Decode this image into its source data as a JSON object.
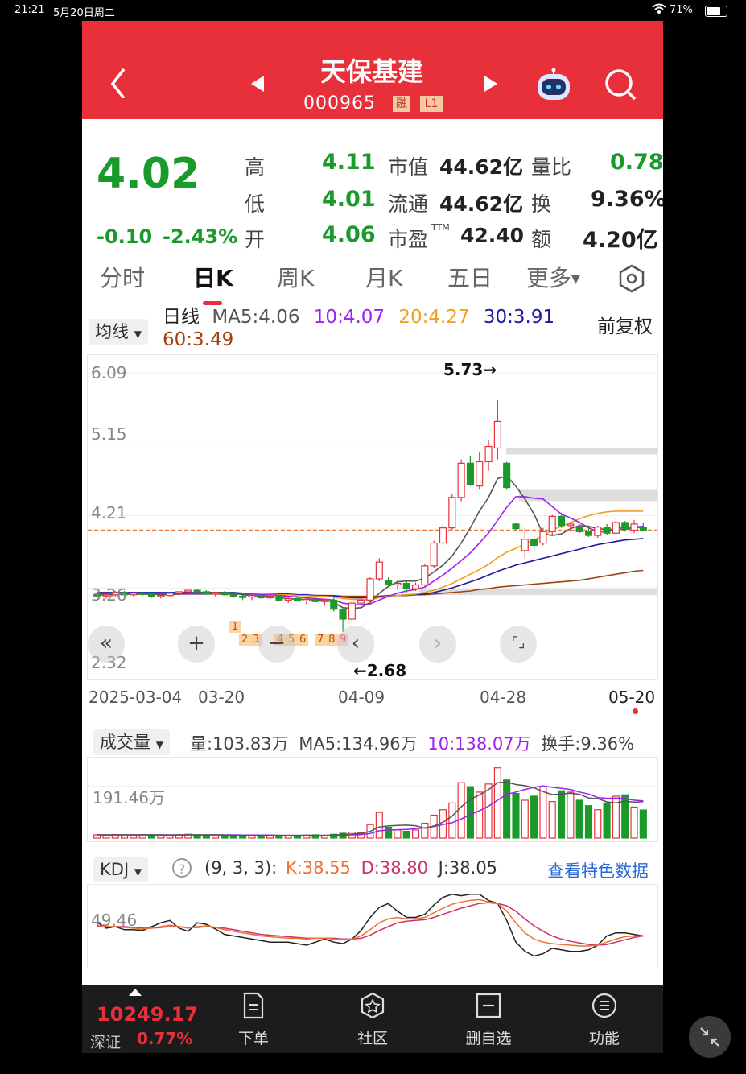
{
  "status": {
    "time": "21:21",
    "date": "5月20日周二",
    "battery": "71%"
  },
  "header": {
    "title": "天保基建",
    "code": "000965",
    "badge_rong": "融",
    "badge_level": "L1"
  },
  "quote": {
    "price": "4.02",
    "change": "-0.10",
    "change_pct": "-2.43%",
    "high_label": "高",
    "high": "4.11",
    "low_label": "低",
    "low": "4.01",
    "open_label": "开",
    "open": "4.06",
    "mktcap_label": "市值",
    "mktcap": "44.62亿",
    "float_label": "流通",
    "float": "44.62亿",
    "pe_label": "市盈",
    "pe_sup": "TTM",
    "pe": "42.40",
    "volratio_label": "量比",
    "volratio": "0.78",
    "turnover_label": "换",
    "turnover": "9.36%",
    "amount_label": "额",
    "amount": "4.20亿"
  },
  "tabs": [
    "分时",
    "日K",
    "周K",
    "月K",
    "五日",
    "更多"
  ],
  "kline": {
    "indicator": "均线",
    "period": "日线",
    "ma5": "MA5:4.06",
    "ma10": "10:4.07",
    "ma20": "20:4.27",
    "ma30": "30:3.91",
    "ma60": "60:3.49",
    "adjust": "前复权",
    "y_labels": [
      "6.09",
      "5.15",
      "4.21",
      "3.26",
      "2.32"
    ],
    "high_mark": "5.73→",
    "low_mark": "←2.68",
    "x_labels": [
      "2025-03-04",
      "03-20",
      "04-09",
      "04-28",
      "05-20"
    ],
    "digits": [
      "1",
      "2",
      "3",
      "4",
      "5",
      "6",
      "7",
      "8",
      "9"
    ],
    "controls": [
      "«",
      "+",
      "−",
      "‹",
      "›",
      "⌜⌟"
    ]
  },
  "volume": {
    "indicator": "成交量",
    "vol": "量:103.83万",
    "ma5": "MA5:134.96万",
    "ma10": "10:138.07万",
    "turnover": "换手:9.36%",
    "y_label": "191.46万"
  },
  "kdj": {
    "indicator": "KDJ",
    "params": "(9, 3, 3):",
    "k": "K:38.55",
    "d": "D:38.80",
    "j": "J:38.05",
    "link": "查看特色数据",
    "y_label": "49.46"
  },
  "bottom": {
    "index_value": "10249.17",
    "index_name": "深证",
    "index_pct": "0.77%",
    "nav": [
      "下单",
      "社区",
      "删自选",
      "功能"
    ]
  },
  "colors": {
    "up": "#e8303a",
    "down": "#1a9a2a",
    "header": "#e8303a",
    "ma10": "#a020f0",
    "ma20": "#f0a020",
    "ma30": "#1a1aa0",
    "ma60": "#a04010"
  },
  "chart_data": [
    {
      "type": "candlestick",
      "title": "",
      "ylim": [
        2.32,
        6.09
      ],
      "x_ticks": [
        "2025-03-04",
        "03-20",
        "04-09",
        "04-28",
        "05-20"
      ],
      "candles": [
        [
          3.17,
          3.2,
          3.12,
          3.16
        ],
        [
          3.16,
          3.18,
          3.12,
          3.17
        ],
        [
          3.17,
          3.22,
          3.14,
          3.2
        ],
        [
          3.2,
          3.22,
          3.15,
          3.17
        ],
        [
          3.17,
          3.21,
          3.14,
          3.19
        ],
        [
          3.19,
          3.21,
          3.16,
          3.18
        ],
        [
          3.18,
          3.19,
          3.13,
          3.15
        ],
        [
          3.15,
          3.18,
          3.12,
          3.16
        ],
        [
          3.16,
          3.2,
          3.14,
          3.19
        ],
        [
          3.19,
          3.22,
          3.16,
          3.21
        ],
        [
          3.21,
          3.24,
          3.18,
          3.23
        ],
        [
          3.23,
          3.25,
          3.19,
          3.21
        ],
        [
          3.21,
          3.23,
          3.17,
          3.18
        ],
        [
          3.18,
          3.21,
          3.15,
          3.2
        ],
        [
          3.2,
          3.22,
          3.16,
          3.17
        ],
        [
          3.17,
          3.19,
          3.13,
          3.15
        ],
        [
          3.15,
          3.18,
          3.1,
          3.14
        ],
        [
          3.14,
          3.17,
          3.1,
          3.16
        ],
        [
          3.16,
          3.18,
          3.12,
          3.13
        ],
        [
          3.13,
          3.16,
          3.1,
          3.15
        ],
        [
          3.15,
          3.17,
          3.08,
          3.1
        ],
        [
          3.1,
          3.14,
          3.06,
          3.12
        ],
        [
          3.12,
          3.15,
          3.08,
          3.09
        ],
        [
          3.09,
          3.13,
          3.05,
          3.11
        ],
        [
          3.11,
          3.14,
          3.07,
          3.08
        ],
        [
          3.08,
          3.12,
          3.04,
          3.1
        ],
        [
          3.1,
          3.13,
          2.95,
          2.98
        ],
        [
          2.98,
          3.0,
          2.68,
          2.85
        ],
        [
          2.85,
          3.08,
          2.82,
          3.06
        ],
        [
          3.06,
          3.12,
          3.02,
          3.1
        ],
        [
          3.1,
          3.4,
          3.08,
          3.38
        ],
        [
          3.38,
          3.65,
          3.35,
          3.6
        ],
        [
          3.36,
          3.4,
          3.28,
          3.3
        ],
        [
          3.3,
          3.36,
          3.24,
          3.32
        ],
        [
          3.32,
          3.36,
          3.2,
          3.25
        ],
        [
          3.25,
          3.33,
          3.22,
          3.3
        ],
        [
          3.3,
          3.58,
          3.28,
          3.55
        ],
        [
          3.55,
          3.88,
          3.52,
          3.85
        ],
        [
          3.85,
          4.1,
          3.82,
          4.05
        ],
        [
          4.05,
          4.5,
          4.02,
          4.45
        ],
        [
          4.45,
          4.95,
          4.4,
          4.9
        ],
        [
          4.9,
          5.0,
          4.6,
          4.62
        ],
        [
          4.6,
          5.05,
          4.55,
          4.92
        ],
        [
          4.92,
          5.2,
          4.8,
          5.12
        ],
        [
          5.1,
          5.73,
          4.95,
          5.45
        ],
        [
          4.9,
          4.92,
          4.55,
          4.58
        ],
        [
          4.1,
          4.12,
          4.02,
          4.04
        ],
        [
          3.75,
          4.05,
          3.65,
          3.9
        ],
        [
          3.9,
          3.96,
          3.75,
          3.82
        ],
        [
          3.85,
          4.05,
          3.82,
          4.0
        ],
        [
          4.0,
          4.22,
          3.95,
          4.2
        ],
        [
          4.2,
          4.25,
          4.05,
          4.08
        ],
        [
          4.08,
          4.12,
          4.0,
          4.1
        ],
        [
          4.05,
          4.1,
          3.98,
          4.0
        ],
        [
          4.0,
          4.06,
          3.93,
          3.95
        ],
        [
          3.95,
          4.08,
          3.92,
          4.06
        ],
        [
          4.06,
          4.1,
          3.96,
          3.98
        ],
        [
          3.98,
          4.18,
          3.95,
          4.12
        ],
        [
          4.12,
          4.14,
          4.0,
          4.03
        ],
        [
          4.02,
          4.15,
          3.98,
          4.1
        ],
        [
          4.06,
          4.11,
          4.01,
          4.02
        ]
      ],
      "ma5": [
        3.17,
        3.17,
        3.17,
        3.18,
        3.18,
        3.18,
        3.18,
        3.17,
        3.17,
        3.18,
        3.19,
        3.2,
        3.2,
        3.2,
        3.2,
        3.19,
        3.17,
        3.16,
        3.15,
        3.15,
        3.13,
        3.12,
        3.11,
        3.11,
        3.1,
        3.1,
        3.07,
        3.0,
        2.99,
        3.0,
        3.07,
        3.19,
        3.28,
        3.34,
        3.35,
        3.35,
        3.39,
        3.47,
        3.56,
        3.68,
        3.85,
        4.05,
        4.27,
        4.45,
        4.7,
        4.73,
        4.6,
        4.43,
        4.23,
        3.97,
        3.95,
        3.97,
        4.04,
        4.08,
        4.07,
        4.04,
        4.03,
        4.03,
        4.03,
        4.05,
        4.06
      ],
      "ma10": [
        3.18,
        3.18,
        3.18,
        3.18,
        3.18,
        3.18,
        3.18,
        3.18,
        3.18,
        3.18,
        3.18,
        3.18,
        3.18,
        3.19,
        3.19,
        3.19,
        3.18,
        3.18,
        3.17,
        3.17,
        3.16,
        3.15,
        3.14,
        3.13,
        3.12,
        3.11,
        3.1,
        3.06,
        3.04,
        3.04,
        3.05,
        3.1,
        3.15,
        3.19,
        3.22,
        3.24,
        3.27,
        3.35,
        3.43,
        3.52,
        3.62,
        3.72,
        3.85,
        3.98,
        4.15,
        4.32,
        4.46,
        4.46,
        4.44,
        4.43,
        4.33,
        4.23,
        4.18,
        4.12,
        4.05,
        4.0,
        4.0,
        4.04,
        4.06,
        4.06,
        4.07
      ],
      "ma20": [
        3.19,
        3.19,
        3.19,
        3.19,
        3.19,
        3.19,
        3.19,
        3.19,
        3.19,
        3.19,
        3.19,
        3.19,
        3.19,
        3.19,
        3.19,
        3.19,
        3.19,
        3.19,
        3.18,
        3.18,
        3.17,
        3.17,
        3.16,
        3.16,
        3.15,
        3.15,
        3.14,
        3.12,
        3.11,
        3.11,
        3.1,
        3.13,
        3.15,
        3.16,
        3.17,
        3.18,
        3.2,
        3.23,
        3.27,
        3.32,
        3.38,
        3.44,
        3.5,
        3.57,
        3.66,
        3.73,
        3.78,
        3.84,
        3.89,
        3.95,
        4.02,
        4.07,
        4.12,
        4.17,
        4.21,
        4.24,
        4.26,
        4.27,
        4.27,
        4.27,
        4.27
      ],
      "ma30": [
        3.2,
        3.2,
        3.2,
        3.2,
        3.2,
        3.2,
        3.2,
        3.2,
        3.2,
        3.2,
        3.2,
        3.2,
        3.2,
        3.2,
        3.2,
        3.2,
        3.19,
        3.19,
        3.19,
        3.19,
        3.18,
        3.18,
        3.17,
        3.17,
        3.16,
        3.16,
        3.15,
        3.14,
        3.13,
        3.13,
        3.13,
        3.14,
        3.15,
        3.16,
        3.17,
        3.17,
        3.18,
        3.2,
        3.23,
        3.26,
        3.3,
        3.34,
        3.38,
        3.43,
        3.48,
        3.52,
        3.56,
        3.59,
        3.62,
        3.65,
        3.68,
        3.71,
        3.74,
        3.77,
        3.8,
        3.83,
        3.85,
        3.87,
        3.89,
        3.9,
        3.91
      ],
      "ma60": [
        3.18,
        3.18,
        3.18,
        3.18,
        3.18,
        3.18,
        3.18,
        3.18,
        3.18,
        3.18,
        3.18,
        3.18,
        3.18,
        3.18,
        3.18,
        3.18,
        3.18,
        3.18,
        3.18,
        3.17,
        3.17,
        3.17,
        3.17,
        3.16,
        3.16,
        3.16,
        3.16,
        3.15,
        3.15,
        3.15,
        3.15,
        3.15,
        3.16,
        3.16,
        3.16,
        3.17,
        3.17,
        3.18,
        3.19,
        3.2,
        3.21,
        3.22,
        3.24,
        3.25,
        3.27,
        3.28,
        3.29,
        3.3,
        3.31,
        3.32,
        3.33,
        3.34,
        3.35,
        3.36,
        3.38,
        3.4,
        3.42,
        3.44,
        3.46,
        3.48,
        3.49
      ]
    },
    {
      "type": "bar",
      "title": "",
      "y_label_value": "191.46万",
      "ylim": [
        0,
        280
      ],
      "volumes": [
        12,
        11,
        13,
        12,
        11,
        13,
        12,
        11,
        10,
        12,
        14,
        12,
        10,
        11,
        10,
        9,
        10,
        9,
        9,
        10,
        10,
        9,
        10,
        11,
        12,
        10,
        14,
        18,
        22,
        20,
        50,
        95,
        40,
        30,
        25,
        30,
        55,
        85,
        105,
        130,
        205,
        190,
        170,
        200,
        260,
        215,
        165,
        140,
        155,
        190,
        135,
        175,
        170,
        140,
        120,
        105,
        130,
        155,
        160,
        115,
        104
      ],
      "vol_ma5": [
        12,
        12,
        12,
        12,
        12,
        12,
        12,
        12,
        11,
        12,
        12,
        12,
        12,
        12,
        11,
        10,
        10,
        10,
        10,
        10,
        10,
        10,
        10,
        10,
        10,
        10,
        11,
        13,
        15,
        17,
        25,
        41,
        45,
        47,
        48,
        46,
        36,
        45,
        59,
        81,
        116,
        143,
        160,
        179,
        205,
        207,
        198,
        194,
        186,
        172,
        161,
        163,
        166,
        162,
        148,
        146,
        134,
        130,
        136,
        133,
        135
      ],
      "vol_ma10": [
        12,
        12,
        12,
        12,
        12,
        12,
        12,
        12,
        12,
        12,
        12,
        12,
        12,
        12,
        12,
        12,
        11,
        11,
        11,
        11,
        10,
        10,
        10,
        10,
        10,
        10,
        10,
        11,
        12,
        13,
        17,
        27,
        30,
        31,
        32,
        35,
        38,
        43,
        50,
        57,
        71,
        87,
        101,
        118,
        140,
        162,
        170,
        180,
        188,
        193,
        188,
        184,
        180,
        170,
        163,
        150,
        147,
        148,
        146,
        140,
        138
      ],
      "up_flags": [
        1,
        1,
        1,
        1,
        1,
        1,
        0,
        1,
        1,
        1,
        1,
        0,
        0,
        1,
        0,
        0,
        0,
        1,
        0,
        1,
        0,
        1,
        0,
        1,
        0,
        1,
        0,
        0,
        1,
        1,
        1,
        1,
        0,
        1,
        0,
        1,
        1,
        1,
        1,
        1,
        1,
        0,
        1,
        1,
        1,
        0,
        0,
        1,
        0,
        1,
        1,
        0,
        1,
        0,
        0,
        1,
        0,
        1,
        0,
        1,
        0
      ]
    },
    {
      "type": "line",
      "title": "",
      "y_label_value": "49.46",
      "ylim": [
        0,
        100
      ],
      "K": [
        52,
        50,
        50,
        49,
        48,
        47,
        48,
        50,
        52,
        50,
        48,
        50,
        51,
        49,
        46,
        44,
        42,
        40,
        38,
        37,
        36,
        35,
        35,
        34,
        35,
        35,
        34,
        33,
        34,
        38,
        46,
        55,
        60,
        62,
        60,
        60,
        62,
        68,
        74,
        79,
        82,
        84,
        85,
        82,
        80,
        70,
        55,
        42,
        34,
        30,
        28,
        27,
        26,
        25,
        25,
        26,
        30,
        34,
        37,
        38,
        38
      ],
      "D": [
        50,
        50,
        50,
        50,
        49,
        48,
        48,
        49,
        50,
        50,
        49,
        49,
        50,
        49,
        48,
        46,
        44,
        42,
        40,
        39,
        38,
        37,
        36,
        35,
        35,
        35,
        35,
        34,
        34,
        35,
        39,
        45,
        50,
        55,
        57,
        58,
        59,
        62,
        66,
        70,
        74,
        77,
        80,
        81,
        80,
        77,
        70,
        60,
        51,
        44,
        38,
        34,
        31,
        29,
        27,
        26,
        27,
        30,
        33,
        36,
        38
      ],
      "J": [
        56,
        48,
        50,
        46,
        46,
        45,
        50,
        55,
        58,
        48,
        44,
        55,
        53,
        47,
        40,
        38,
        36,
        34,
        32,
        30,
        30,
        30,
        28,
        26,
        30,
        34,
        30,
        28,
        34,
        45,
        62,
        75,
        80,
        70,
        62,
        62,
        66,
        78,
        88,
        92,
        90,
        92,
        92,
        84,
        80,
        58,
        30,
        18,
        12,
        15,
        22,
        20,
        18,
        18,
        20,
        26,
        38,
        42,
        42,
        40,
        38
      ]
    }
  ]
}
